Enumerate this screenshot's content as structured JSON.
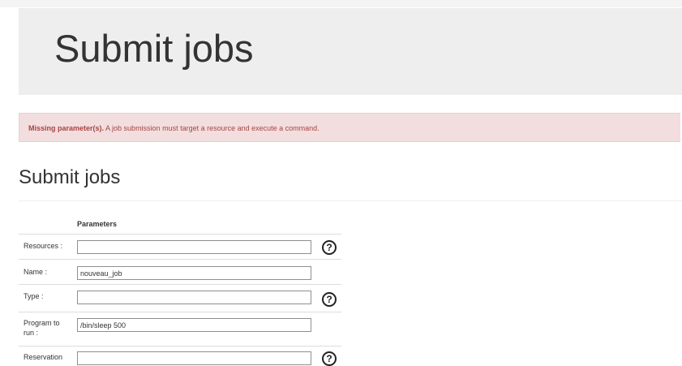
{
  "jumbotron": {
    "title": "Submit jobs"
  },
  "alert": {
    "strong": "Missing parameter(s).",
    "message": " A job submission must target a resource and execute a command."
  },
  "section": {
    "title": "Submit jobs"
  },
  "form": {
    "column_header": "Parameters",
    "fields": {
      "resources": {
        "label": "Resources :",
        "value": ""
      },
      "name": {
        "label": "Name :",
        "value": "nouveau_job"
      },
      "type": {
        "label": "Type :",
        "value": ""
      },
      "program": {
        "label": "Program to run :",
        "value": "/bin/sleep 500"
      },
      "reservation": {
        "label": "Reservation",
        "value": ""
      }
    },
    "help_icon": "?"
  },
  "colors": {
    "alert_bg": "#f2dede",
    "alert_text": "#a94442",
    "jumbotron_bg": "#eeeeee"
  }
}
